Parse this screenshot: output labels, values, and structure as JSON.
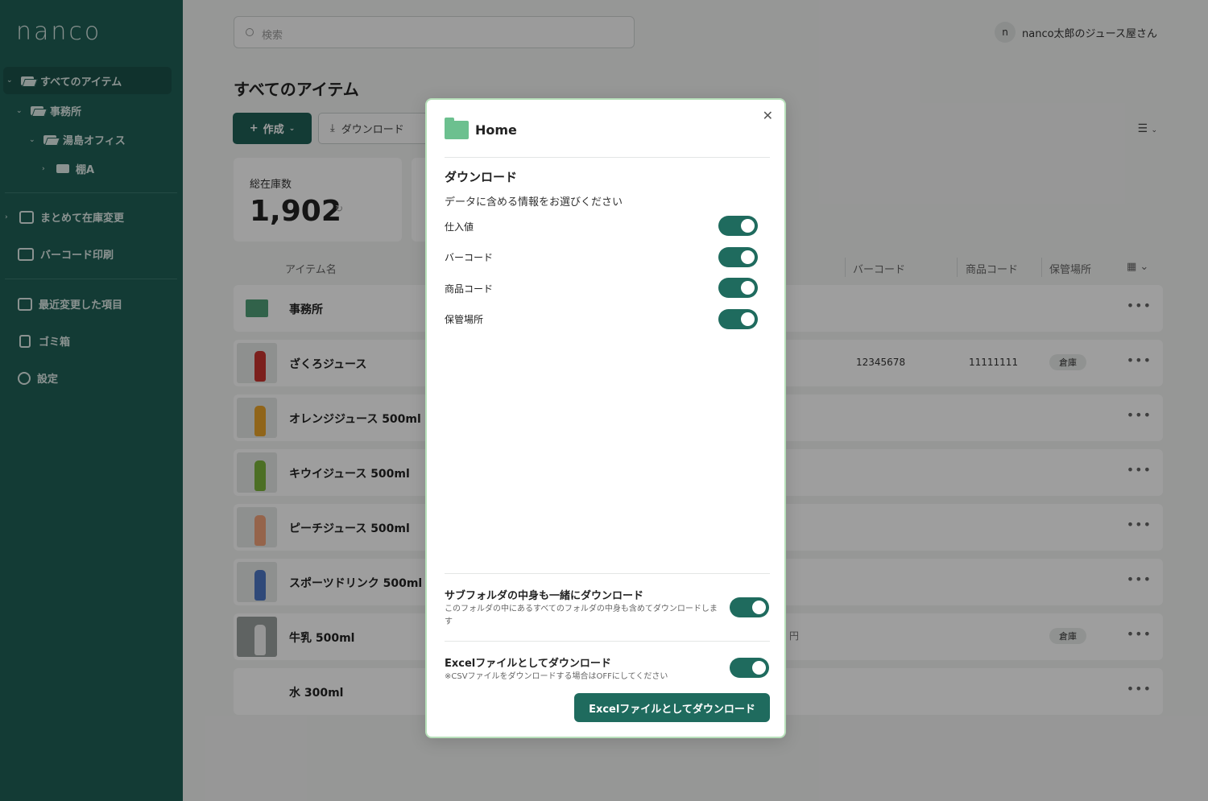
{
  "sidebar": {
    "logo": "nanco",
    "tree": [
      {
        "label": "すべてのアイテム"
      },
      {
        "label": "事務所"
      },
      {
        "label": "湯島オフィス"
      },
      {
        "label": "棚A"
      }
    ],
    "menu": [
      {
        "label": "まとめて在庫変更"
      },
      {
        "label": "バーコード印刷"
      },
      {
        "label": "最近変更した項目"
      },
      {
        "label": "ゴミ箱"
      },
      {
        "label": "設定"
      }
    ]
  },
  "header": {
    "search_placeholder": "検索",
    "user_initial": "n",
    "user_name": "nanco太郎のジュース屋さん"
  },
  "main": {
    "title": "すべてのアイテム",
    "create_label": "作成",
    "download_label": "ダウンロード",
    "stat_label": "総在庫数",
    "stat_value": "1,902",
    "columns": {
      "name": "アイテム名",
      "barcode": "バーコード",
      "product_code": "商品コード",
      "location": "保管場所"
    },
    "rows": [
      {
        "name": "事務所"
      },
      {
        "name": "ざくろジュース",
        "barcode": "12345678",
        "product_code": "11111111",
        "location": "倉庫"
      },
      {
        "name": "オレンジジュース 500ml"
      },
      {
        "name": "キウイジュース 500ml"
      },
      {
        "name": "ピーチジュース 500ml"
      },
      {
        "name": "スポーツドリンク 500ml"
      },
      {
        "name": "牛乳 500ml",
        "price_frag": "円",
        "location": "倉庫"
      },
      {
        "name": "水 300ml"
      }
    ]
  },
  "modal": {
    "folder_name": "Home",
    "heading": "ダウンロード",
    "subheading": "データに含める情報をお選びください",
    "options": [
      {
        "label": "仕入値",
        "on": true
      },
      {
        "label": "バーコード",
        "on": true
      },
      {
        "label": "商品コード",
        "on": true
      },
      {
        "label": "保管場所",
        "on": true
      }
    ],
    "subfolder_title": "サブフォルダの中身も一緒にダウンロード",
    "subfolder_desc": "このフォルダの中にあるすべてのフォルダの中身も含めてダウンロードします",
    "excel_title": "Excelファイルとしてダウンロード",
    "excel_desc": "※CSVファイルをダウンロードする場合はOFFにしてください",
    "submit_label": "Excelファイルとしてダウンロード",
    "accent_color": "#1f6b5e"
  }
}
